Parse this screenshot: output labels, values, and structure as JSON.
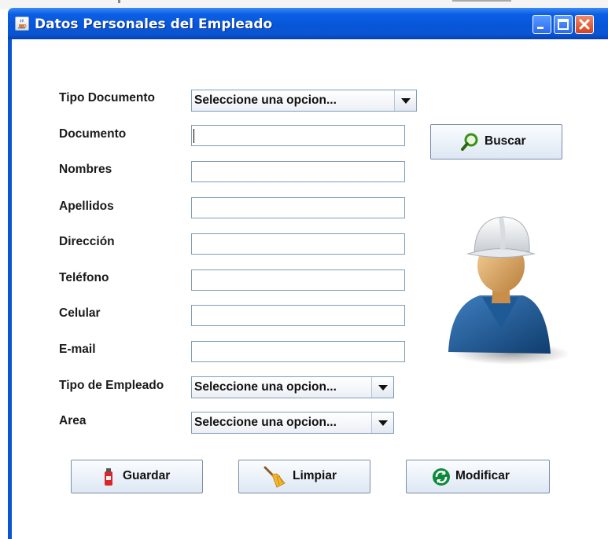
{
  "window": {
    "title": "Datos Personales del Empleado",
    "icon": "java-cup-icon",
    "controls": [
      "minimize-icon",
      "maximize-icon",
      "close-icon"
    ]
  },
  "form": {
    "tipo_documento": {
      "label": "Tipo Documento",
      "value": "Seleccione una opcion..."
    },
    "documento": {
      "label": "Documento",
      "value": ""
    },
    "nombres": {
      "label": "Nombres",
      "value": ""
    },
    "apellidos": {
      "label": "Apellidos",
      "value": ""
    },
    "direccion": {
      "label": "Dirección",
      "value": ""
    },
    "telefono": {
      "label": "Teléfono",
      "value": ""
    },
    "celular": {
      "label": "Celular",
      "value": ""
    },
    "email": {
      "label": "E-mail",
      "value": ""
    },
    "tipo_empleado": {
      "label": "Tipo de Empleado",
      "value": "Seleccione una opcion..."
    },
    "area": {
      "label": "Area",
      "value": "Seleccione una opcion..."
    }
  },
  "buttons": {
    "buscar": {
      "label": "Buscar",
      "icon": "magnifier-icon"
    },
    "guardar": {
      "label": "Guardar",
      "icon": "fire-extinguisher-icon"
    },
    "limpiar": {
      "label": "Limpiar",
      "icon": "broom-icon"
    },
    "modificar": {
      "label": "Modificar",
      "icon": "refresh-icon"
    }
  },
  "image": {
    "icon": "worker-hardhat-avatar-icon"
  },
  "colors": {
    "titlebar": "#0a55d2",
    "close_button": "#d5431f",
    "field_border": "#7f9db9"
  }
}
